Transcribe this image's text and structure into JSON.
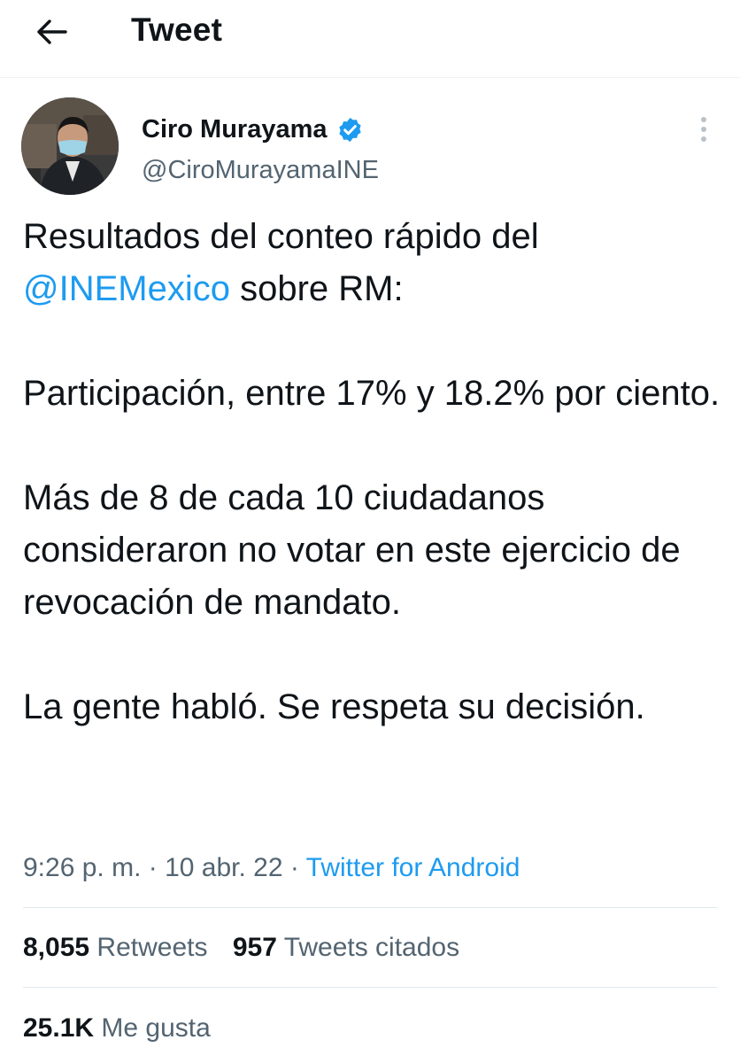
{
  "header": {
    "title": "Tweet"
  },
  "author": {
    "name": "Ciro Murayama",
    "handle": "@CiroMurayamaINE",
    "verified": true
  },
  "tweet": {
    "line1": "Resultados del conteo rápido del",
    "mention": "@INEMexico",
    "line2_rest": " sobre RM:",
    "para2": "Participación, entre 17% y 18.2% por ciento.",
    "para3": "Más de 8 de cada 10 ciudadanos consideraron no votar en este ejercicio de revocación de mandato.",
    "para4": "La gente habló. Se respeta su decisión."
  },
  "meta": {
    "time": "9:26 p. m.",
    "sep1": " · ",
    "date": "10 abr. 22",
    "sep2": " · ",
    "source": "Twitter for Android"
  },
  "stats": {
    "retweets_count": "8,055",
    "retweets_label": "Retweets",
    "quotes_count": "957",
    "quotes_label": "Tweets citados",
    "likes_count": "25.1K",
    "likes_label": "Me gusta"
  },
  "colors": {
    "accent": "#1d9bf0",
    "text": "#0f1419",
    "secondary": "#536471"
  }
}
